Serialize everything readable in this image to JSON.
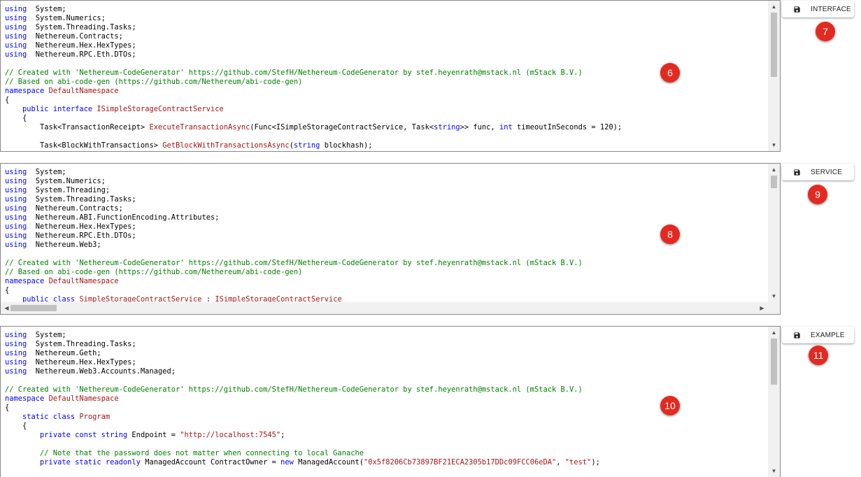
{
  "panels": [
    {
      "id": "interface",
      "button_label": "INTERFACE",
      "button_badge": "7",
      "code_badge": "6",
      "lines": [
        [
          [
            "kw",
            "using"
          ],
          [
            "",
            "  System;"
          ]
        ],
        [
          [
            "kw",
            "using"
          ],
          [
            "",
            "  System.Numerics;"
          ]
        ],
        [
          [
            "kw",
            "using"
          ],
          [
            "",
            "  System.Threading.Tasks;"
          ]
        ],
        [
          [
            "kw",
            "using"
          ],
          [
            "",
            "  Nethereum.Contracts;"
          ]
        ],
        [
          [
            "kw",
            "using"
          ],
          [
            "",
            "  Nethereum.Hex.HexTypes;"
          ]
        ],
        [
          [
            "kw",
            "using"
          ],
          [
            "",
            "  Nethereum.RPC.Eth.DTOs;"
          ]
        ],
        [
          [
            "",
            ""
          ]
        ],
        [
          [
            "cm",
            "// Created with 'Nethereum-CodeGenerator' https://github.com/StefH/Nethereum-CodeGenerator by stef.heyenrath@mstack.nl (mStack B.V.)"
          ]
        ],
        [
          [
            "cm",
            "// Based on abi-code-gen (https://github.com/Nethereum/abi-code-gen)"
          ]
        ],
        [
          [
            "kw",
            "namespace"
          ],
          [
            "ty",
            " DefaultNamespace"
          ]
        ],
        [
          [
            "",
            "{"
          ]
        ],
        [
          [
            "",
            "    "
          ],
          [
            "kw",
            "public interface"
          ],
          [
            "ty",
            " ISimpleStorageContractService"
          ]
        ],
        [
          [
            "",
            "    {"
          ]
        ],
        [
          [
            "",
            "        Task<TransactionReceipt> "
          ],
          [
            "ty",
            "ExecuteTransactionAsync"
          ],
          [
            "",
            "(Func<ISimpleStorageContractService, Task<"
          ],
          [
            "kw",
            "string"
          ],
          [
            "",
            ">> func, "
          ],
          [
            "kw",
            "int"
          ],
          [
            "",
            " timeoutInSeconds = 120);"
          ]
        ],
        [
          [
            "",
            ""
          ]
        ],
        [
          [
            "",
            "        Task<BlockWithTransactions> "
          ],
          [
            "ty",
            "GetBlockWithTransactionsAsync"
          ],
          [
            "",
            "("
          ],
          [
            "kw",
            "string"
          ],
          [
            "",
            " blockhash);"
          ]
        ]
      ]
    },
    {
      "id": "service",
      "button_label": "SERVICE",
      "button_badge": "9",
      "code_badge": "8",
      "lines": [
        [
          [
            "kw",
            "using"
          ],
          [
            "",
            "  System;"
          ]
        ],
        [
          [
            "kw",
            "using"
          ],
          [
            "",
            "  System.Numerics;"
          ]
        ],
        [
          [
            "kw",
            "using"
          ],
          [
            "",
            "  System.Threading;"
          ]
        ],
        [
          [
            "kw",
            "using"
          ],
          [
            "",
            "  System.Threading.Tasks;"
          ]
        ],
        [
          [
            "kw",
            "using"
          ],
          [
            "",
            "  Nethereum.Contracts;"
          ]
        ],
        [
          [
            "kw",
            "using"
          ],
          [
            "",
            "  Nethereum.ABI.FunctionEncoding.Attributes;"
          ]
        ],
        [
          [
            "kw",
            "using"
          ],
          [
            "",
            "  Nethereum.Hex.HexTypes;"
          ]
        ],
        [
          [
            "kw",
            "using"
          ],
          [
            "",
            "  Nethereum.RPC.Eth.DTOs;"
          ]
        ],
        [
          [
            "kw",
            "using"
          ],
          [
            "",
            "  Nethereum.Web3;"
          ]
        ],
        [
          [
            "",
            ""
          ]
        ],
        [
          [
            "cm",
            "// Created with 'Nethereum-CodeGenerator' https://github.com/StefH/Nethereum-CodeGenerator by stef.heyenrath@mstack.nl (mStack B.V.)"
          ]
        ],
        [
          [
            "cm",
            "// Based on abi-code-gen (https://github.com/Nethereum/abi-code-gen)"
          ]
        ],
        [
          [
            "kw",
            "namespace"
          ],
          [
            "ty",
            " DefaultNamespace"
          ]
        ],
        [
          [
            "",
            "{"
          ]
        ],
        [
          [
            "",
            "    "
          ],
          [
            "kw",
            "public class"
          ],
          [
            "ty",
            " SimpleStorageContractService"
          ],
          [
            "",
            " : "
          ],
          [
            "ty",
            "ISimpleStorageContractService"
          ]
        ]
      ]
    },
    {
      "id": "example",
      "button_label": "EXAMPLE",
      "button_badge": "11",
      "code_badge": "10",
      "lines": [
        [
          [
            "kw",
            "using"
          ],
          [
            "",
            "  System;"
          ]
        ],
        [
          [
            "kw",
            "using"
          ],
          [
            "",
            "  System.Threading.Tasks;"
          ]
        ],
        [
          [
            "kw",
            "using"
          ],
          [
            "",
            "  Nethereum.Geth;"
          ]
        ],
        [
          [
            "kw",
            "using"
          ],
          [
            "",
            "  Nethereum.Hex.HexTypes;"
          ]
        ],
        [
          [
            "kw",
            "using"
          ],
          [
            "",
            "  Nethereum.Web3.Accounts.Managed;"
          ]
        ],
        [
          [
            "",
            ""
          ]
        ],
        [
          [
            "cm",
            "// Created with 'Nethereum-CodeGenerator' https://github.com/StefH/Nethereum-CodeGenerator by stef.heyenrath@mstack.nl (mStack B.V.)"
          ]
        ],
        [
          [
            "kw",
            "namespace"
          ],
          [
            "ty",
            " DefaultNamespace"
          ]
        ],
        [
          [
            "",
            "{"
          ]
        ],
        [
          [
            "",
            "    "
          ],
          [
            "kw",
            "static class"
          ],
          [
            "ty",
            " Program"
          ]
        ],
        [
          [
            "",
            "    {"
          ]
        ],
        [
          [
            "",
            "        "
          ],
          [
            "kw",
            "private const string"
          ],
          [
            "",
            " Endpoint = "
          ],
          [
            "st",
            "\"http://localhost:7545\""
          ],
          [
            "",
            ";"
          ]
        ],
        [
          [
            "",
            ""
          ]
        ],
        [
          [
            "cm",
            "        // Note that the password does not matter when connecting to local Ganache"
          ]
        ],
        [
          [
            "",
            "        "
          ],
          [
            "kw",
            "private static readonly"
          ],
          [
            "",
            " ManagedAccount ContractOwner = "
          ],
          [
            "kw",
            "new"
          ],
          [
            "",
            " ManagedAccount("
          ],
          [
            "st",
            "\"0x5f8206Cb73897BF21ECA2305b17DDc09FCC06eDA\""
          ],
          [
            "",
            ", "
          ],
          [
            "st",
            "\"test\""
          ],
          [
            "",
            ");"
          ]
        ]
      ]
    }
  ]
}
